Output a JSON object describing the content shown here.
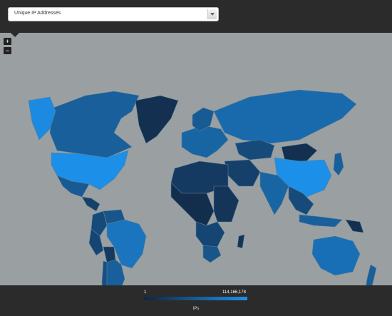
{
  "selector": {
    "value": "Unique IP Addresses",
    "icon": "chevron-down-icon"
  },
  "zoom": {
    "in_label": "+",
    "out_label": "−"
  },
  "legend": {
    "min": "1",
    "max": "114,166,178",
    "title": "IPs",
    "color_low": "#12253f",
    "color_high": "#1c8fe8"
  },
  "map": {
    "ocean_color": "#9aa0a2",
    "border_color": "#5d7f96",
    "regions": [
      {
        "name": "Canada",
        "level": 0.55
      },
      {
        "name": "United States",
        "level": 1.0
      },
      {
        "name": "Alaska",
        "level": 0.95
      },
      {
        "name": "Greenland",
        "level": 0.1
      },
      {
        "name": "Mexico",
        "level": 0.5
      },
      {
        "name": "Central America",
        "level": 0.25
      },
      {
        "name": "Colombia",
        "level": 0.35
      },
      {
        "name": "Venezuela",
        "level": 0.45
      },
      {
        "name": "Brazil",
        "level": 0.75
      },
      {
        "name": "Peru",
        "level": 0.3
      },
      {
        "name": "Bolivia",
        "level": 0.2
      },
      {
        "name": "Chile",
        "level": 0.4
      },
      {
        "name": "Argentina",
        "level": 0.55
      },
      {
        "name": "Europe",
        "level": 0.6
      },
      {
        "name": "Scandinavia",
        "level": 0.5
      },
      {
        "name": "Russia",
        "level": 0.65
      },
      {
        "name": "Kazakhstan",
        "level": 0.35
      },
      {
        "name": "Mongolia",
        "level": 0.1
      },
      {
        "name": "China",
        "level": 1.0
      },
      {
        "name": "Middle East",
        "level": 0.25
      },
      {
        "name": "India",
        "level": 0.6
      },
      {
        "name": "Southeast Asia",
        "level": 0.35
      },
      {
        "name": "Japan",
        "level": 0.55
      },
      {
        "name": "North Africa",
        "level": 0.2
      },
      {
        "name": "Central Africa",
        "level": 0.08
      },
      {
        "name": "East Africa",
        "level": 0.15
      },
      {
        "name": "Southern Africa",
        "level": 0.3
      },
      {
        "name": "South Africa",
        "level": 0.45
      },
      {
        "name": "Madagascar",
        "level": 0.15
      },
      {
        "name": "Indonesia",
        "level": 0.55
      },
      {
        "name": "Papua New Guinea",
        "level": 0.1
      },
      {
        "name": "Australia",
        "level": 0.7
      },
      {
        "name": "New Zealand",
        "level": 0.55
      }
    ]
  }
}
